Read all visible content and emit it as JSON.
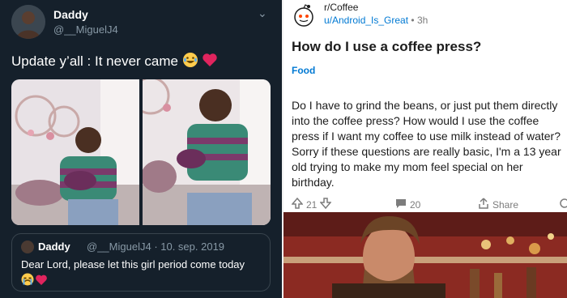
{
  "tweet": {
    "name": "Daddy",
    "handle": "@__MiguelJ4",
    "text": "Update y’all : It never came",
    "emojis": [
      "rofl-emoji",
      "red-heart-emoji"
    ]
  },
  "quote": {
    "name": "Daddy",
    "handle": "@__MiguelJ4",
    "date": "· 10. sep. 2019",
    "text": "Dear Lord, please let this girl period come today",
    "emojis": [
      "crying-emoji",
      "red-heart-emoji"
    ]
  },
  "reddit": {
    "subreddit": "r/Coffee",
    "user": "u/Android_Is_Great",
    "time": "• 3h",
    "title": "How do I use a coffee press?",
    "flair": "Food",
    "body": "Do I have to grind the beans, or just put them directly into the coffee press? How would I use the coffee press if I want my coffee to use milk instead of water? Sorry if these questions are really basic, I'm a 13 year old trying to make my mom feel special on her birthday.",
    "upvotes": "21",
    "comments": "20",
    "share": "Share"
  },
  "colors": {
    "twitter_bg": "#15202b",
    "twitter_muted": "#8899a6",
    "reddit_blue": "#0079d3",
    "heart_red": "#e0245e"
  }
}
